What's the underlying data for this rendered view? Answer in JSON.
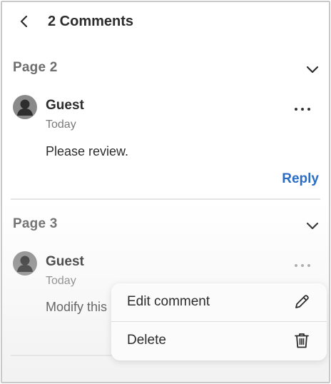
{
  "header": {
    "title": "2 Comments",
    "back_icon": "chevron-left-icon"
  },
  "sections": [
    {
      "page_label": "Page 2",
      "comment": {
        "author": "Guest",
        "time": "Today",
        "text": "Please review."
      },
      "reply_label": "Reply"
    },
    {
      "page_label": "Page 3",
      "comment": {
        "author": "Guest",
        "time": "Today",
        "text": "Modify this"
      }
    }
  ],
  "context_menu": {
    "items": [
      {
        "label": "Edit comment",
        "icon": "pencil-icon"
      },
      {
        "label": "Delete",
        "icon": "trash-icon"
      }
    ]
  },
  "colors": {
    "accent": "#2b6cc4",
    "avatar": "#8a8a8a",
    "muted_text": "#7a7a7a"
  }
}
